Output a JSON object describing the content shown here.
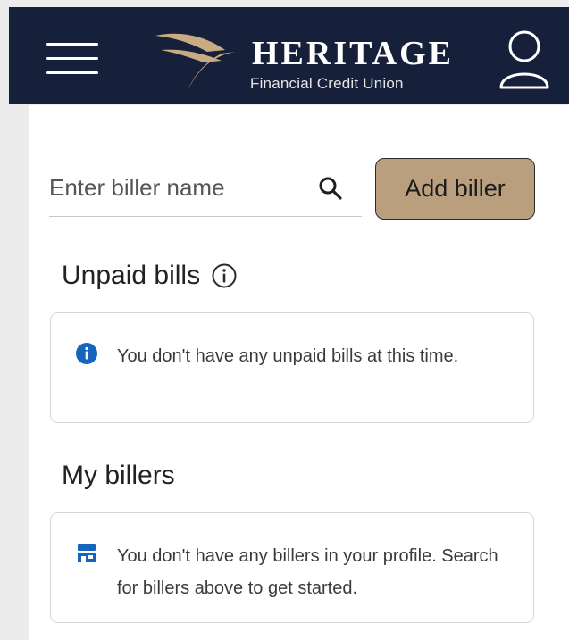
{
  "header": {
    "brand_name": "HERITAGE",
    "brand_subtitle": "Financial Credit Union",
    "menu_icon": "hamburger-menu-icon",
    "user_icon": "user-profile-icon"
  },
  "search": {
    "placeholder": "Enter biller name",
    "value": "",
    "icon": "search-icon"
  },
  "add_biller": {
    "label": "Add biller"
  },
  "unpaid_bills": {
    "title": "Unpaid bills",
    "title_icon": "info-outline-icon",
    "message": "You don't have any unpaid bills at this time.",
    "message_icon": "info-filled-icon"
  },
  "my_billers": {
    "title": "My billers",
    "message": "You don't have any billers in your profile. Search for billers above to get started.",
    "message_icon": "store-icon"
  },
  "colors": {
    "header_bg": "#17203a",
    "accent_gold": "#b99f7d",
    "info_blue": "#1565c0"
  }
}
